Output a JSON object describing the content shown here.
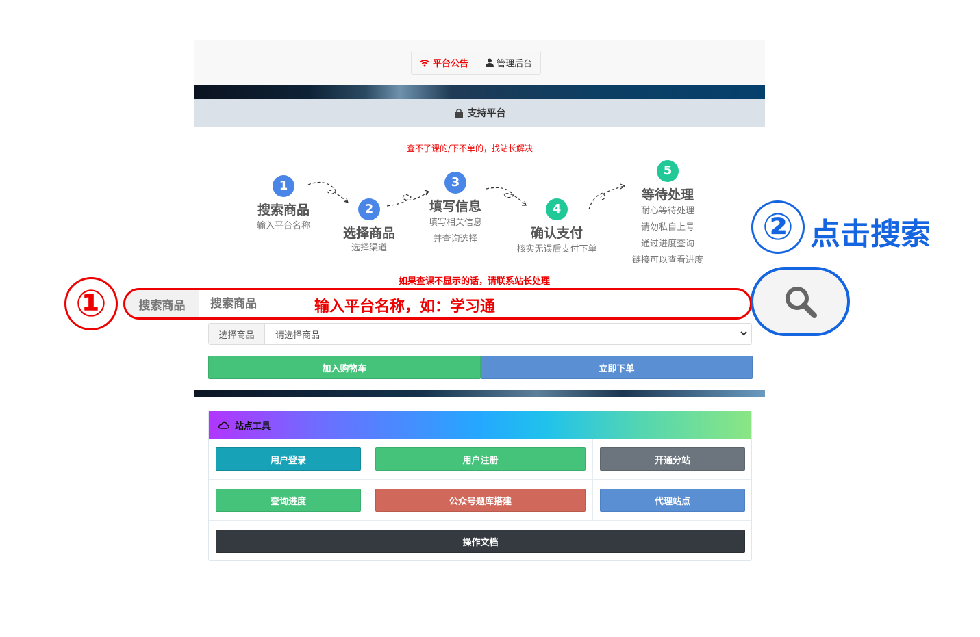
{
  "nav": {
    "announcement": "平台公告",
    "admin": "管理后台"
  },
  "support": {
    "label": "支持平台"
  },
  "notice_top": "查不了课的/下不单的，找站长解决",
  "steps": [
    {
      "num": "1",
      "title": "搜索商品",
      "desc1": "输入平台名称",
      "desc2": "",
      "color": "#4a86e8"
    },
    {
      "num": "2",
      "title": "选择商品",
      "desc1": "选择渠道",
      "desc2": "",
      "color": "#4a86e8"
    },
    {
      "num": "3",
      "title": "填写信息",
      "desc1": "填写相关信息",
      "desc2": "并查询选择",
      "color": "#4a86e8"
    },
    {
      "num": "4",
      "title": "确认支付",
      "desc1": "核实无误后支付下单",
      "desc2": "",
      "color": "#20c997"
    },
    {
      "num": "5",
      "title": "等待处理",
      "desc1": "耐心等待处理",
      "desc2": "请勿私自上号",
      "desc3": "通过进度查询",
      "desc4": "链接可以查看进度",
      "color": "#20c997"
    }
  ],
  "notice_contact": "如果查课不显示的话，请联系站长处理",
  "search": {
    "label": "搜索商品",
    "placeholder": "搜索商品",
    "hint": "输入平台名称，如：学习通"
  },
  "annotations": {
    "one": "①",
    "two": "②",
    "click_search": "点击搜索"
  },
  "select": {
    "label": "选择商品",
    "value": "请选择商品"
  },
  "actions": {
    "add_cart": "加入购物车",
    "order_now": "立即下单"
  },
  "tools": {
    "title": "站点工具",
    "buttons": [
      {
        "label": "用户登录",
        "color": "#17a2b8"
      },
      {
        "label": "用户注册",
        "color": "#45c37a"
      },
      {
        "label": "开通分站",
        "color": "#6c757d"
      },
      {
        "label": "查询进度",
        "color": "#45c37a"
      },
      {
        "label": "公众号题库搭建",
        "color": "#d0695b"
      },
      {
        "label": "代理站点",
        "color": "#5b8fd4"
      }
    ],
    "docs": "操作文档",
    "docs_color": "#343a40"
  },
  "colors": {
    "red": "#ee0000",
    "blue": "#1565e0",
    "green": "#45c37a",
    "order_blue": "#5b8fd4"
  }
}
